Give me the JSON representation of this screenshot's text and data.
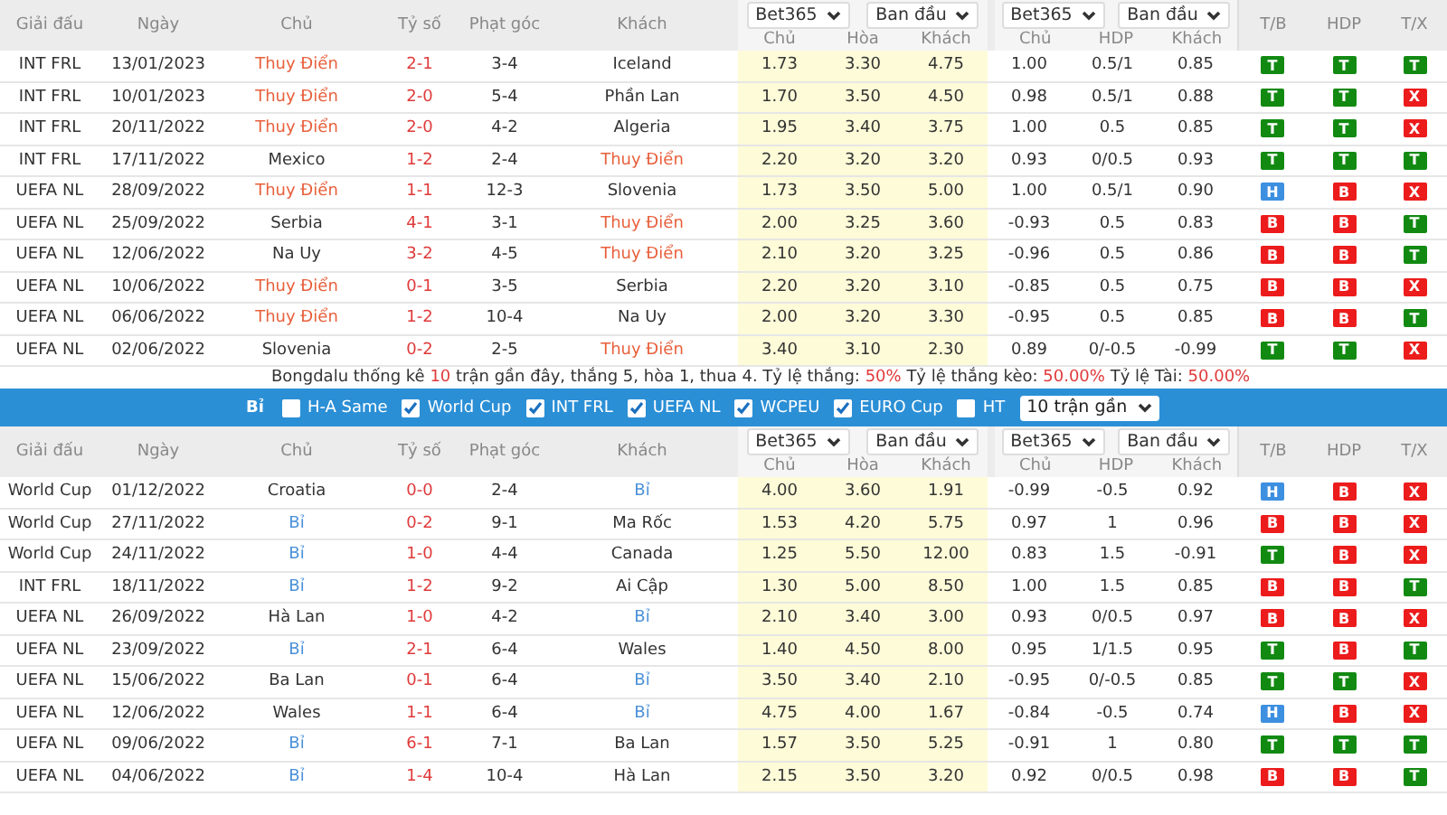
{
  "sections": [
    {
      "header": {
        "columns": [
          "Giải đấu",
          "Ngày",
          "Chủ",
          "Tỷ số",
          "Phạt góc",
          "Khách"
        ],
        "odds_groups": [
          {
            "bookmaker": "Bet365",
            "period": "Ban đầu",
            "columns": [
              "Chủ",
              "Hòa",
              "Khách"
            ]
          },
          {
            "bookmaker": "Bet365",
            "period": "Ban đầu",
            "columns": [
              "Chủ",
              "HDP",
              "Khách"
            ]
          }
        ],
        "result_columns": [
          "T/B",
          "HDP",
          "T/X"
        ]
      },
      "rows": [
        {
          "league": "INT FRL",
          "date": "13/01/2023",
          "home": {
            "name": "Thuy Điển",
            "color": "#e8603c"
          },
          "score": "2-1",
          "corners": "3-4",
          "away": {
            "name": "Iceland",
            "color": "#333333"
          },
          "odds": [
            "1.73",
            "3.30",
            "4.75"
          ],
          "handicap": [
            "1.00",
            "0.5/1",
            "0.85"
          ],
          "results": [
            {
              "label": "T",
              "color": "#128a12"
            },
            {
              "label": "T",
              "color": "#128a12"
            },
            {
              "label": "T",
              "color": "#128a12"
            }
          ]
        },
        {
          "league": "INT FRL",
          "date": "10/01/2023",
          "home": {
            "name": "Thuy Điển",
            "color": "#e8603c"
          },
          "score": "2-0",
          "corners": "5-4",
          "away": {
            "name": "Phần Lan",
            "color": "#333333"
          },
          "odds": [
            "1.70",
            "3.50",
            "4.50"
          ],
          "handicap": [
            "0.98",
            "0.5/1",
            "0.88"
          ],
          "results": [
            {
              "label": "T",
              "color": "#128a12"
            },
            {
              "label": "T",
              "color": "#128a12"
            },
            {
              "label": "X",
              "color": "#ec1c1c"
            }
          ]
        },
        {
          "league": "INT FRL",
          "date": "20/11/2022",
          "home": {
            "name": "Thuy Điển",
            "color": "#e8603c"
          },
          "score": "2-0",
          "corners": "4-2",
          "away": {
            "name": "Algeria",
            "color": "#333333"
          },
          "odds": [
            "1.95",
            "3.40",
            "3.75"
          ],
          "handicap": [
            "1.00",
            "0.5",
            "0.85"
          ],
          "results": [
            {
              "label": "T",
              "color": "#128a12"
            },
            {
              "label": "T",
              "color": "#128a12"
            },
            {
              "label": "X",
              "color": "#ec1c1c"
            }
          ]
        },
        {
          "league": "INT FRL",
          "date": "17/11/2022",
          "home": {
            "name": "Mexico",
            "color": "#333333"
          },
          "score": "1-2",
          "corners": "2-4",
          "away": {
            "name": "Thuy Điển",
            "color": "#e8603c"
          },
          "odds": [
            "2.20",
            "3.20",
            "3.20"
          ],
          "handicap": [
            "0.93",
            "0/0.5",
            "0.93"
          ],
          "results": [
            {
              "label": "T",
              "color": "#128a12"
            },
            {
              "label": "T",
              "color": "#128a12"
            },
            {
              "label": "T",
              "color": "#128a12"
            }
          ]
        },
        {
          "league": "UEFA NL",
          "date": "28/09/2022",
          "home": {
            "name": "Thuy Điển",
            "color": "#e8603c"
          },
          "score": "1-1",
          "corners": "12-3",
          "away": {
            "name": "Slovenia",
            "color": "#333333"
          },
          "odds": [
            "1.73",
            "3.50",
            "5.00"
          ],
          "handicap": [
            "1.00",
            "0.5/1",
            "0.90"
          ],
          "results": [
            {
              "label": "H",
              "color": "#3d8fe0"
            },
            {
              "label": "B",
              "color": "#ec1c1c"
            },
            {
              "label": "X",
              "color": "#ec1c1c"
            }
          ]
        },
        {
          "league": "UEFA NL",
          "date": "25/09/2022",
          "home": {
            "name": "Serbia",
            "color": "#333333"
          },
          "score": "4-1",
          "corners": "3-1",
          "away": {
            "name": "Thuy Điển",
            "color": "#e8603c"
          },
          "odds": [
            "2.00",
            "3.25",
            "3.60"
          ],
          "handicap": [
            "-0.93",
            "0.5",
            "0.83"
          ],
          "results": [
            {
              "label": "B",
              "color": "#ec1c1c"
            },
            {
              "label": "B",
              "color": "#ec1c1c"
            },
            {
              "label": "T",
              "color": "#128a12"
            }
          ]
        },
        {
          "league": "UEFA NL",
          "date": "12/06/2022",
          "home": {
            "name": "Na Uy",
            "color": "#333333"
          },
          "score": "3-2",
          "corners": "4-5",
          "away": {
            "name": "Thuy Điển",
            "color": "#e8603c"
          },
          "odds": [
            "2.10",
            "3.20",
            "3.25"
          ],
          "handicap": [
            "-0.96",
            "0.5",
            "0.86"
          ],
          "results": [
            {
              "label": "B",
              "color": "#ec1c1c"
            },
            {
              "label": "B",
              "color": "#ec1c1c"
            },
            {
              "label": "T",
              "color": "#128a12"
            }
          ]
        },
        {
          "league": "UEFA NL",
          "date": "10/06/2022",
          "home": {
            "name": "Thuy Điển",
            "color": "#e8603c"
          },
          "score": "0-1",
          "corners": "3-5",
          "away": {
            "name": "Serbia",
            "color": "#333333"
          },
          "odds": [
            "2.20",
            "3.20",
            "3.10"
          ],
          "handicap": [
            "-0.85",
            "0.5",
            "0.75"
          ],
          "results": [
            {
              "label": "B",
              "color": "#ec1c1c"
            },
            {
              "label": "B",
              "color": "#ec1c1c"
            },
            {
              "label": "X",
              "color": "#ec1c1c"
            }
          ]
        },
        {
          "league": "UEFA NL",
          "date": "06/06/2022",
          "home": {
            "name": "Thuy Điển",
            "color": "#e8603c"
          },
          "score": "1-2",
          "corners": "10-4",
          "away": {
            "name": "Na Uy",
            "color": "#333333"
          },
          "odds": [
            "2.00",
            "3.20",
            "3.30"
          ],
          "handicap": [
            "-0.95",
            "0.5",
            "0.85"
          ],
          "results": [
            {
              "label": "B",
              "color": "#ec1c1c"
            },
            {
              "label": "B",
              "color": "#ec1c1c"
            },
            {
              "label": "T",
              "color": "#128a12"
            }
          ]
        },
        {
          "league": "UEFA NL",
          "date": "02/06/2022",
          "home": {
            "name": "Slovenia",
            "color": "#333333"
          },
          "score": "0-2",
          "corners": "2-5",
          "away": {
            "name": "Thuy Điển",
            "color": "#e8603c"
          },
          "odds": [
            "3.40",
            "3.10",
            "2.30"
          ],
          "handicap": [
            "0.89",
            "0/-0.5",
            "-0.99"
          ],
          "results": [
            {
              "label": "T",
              "color": "#128a12"
            },
            {
              "label": "T",
              "color": "#128a12"
            },
            {
              "label": "X",
              "color": "#ec1c1c"
            }
          ]
        }
      ],
      "summary": [
        {
          "text": "Bongdalu thống kê ",
          "highlight": false
        },
        {
          "text": "10",
          "highlight": true
        },
        {
          "text": " trận gần đây, thắng 5, hòa 1, thua 4. Tỷ lệ thắng: ",
          "highlight": false
        },
        {
          "text": "50%",
          "highlight": true
        },
        {
          "text": " Tỷ lệ thắng kèo: ",
          "highlight": false
        },
        {
          "text": "50.00%",
          "highlight": true
        },
        {
          "text": " Tỷ lệ Tài: ",
          "highlight": false
        },
        {
          "text": "50.00%",
          "highlight": true
        }
      ]
    },
    {
      "filter_bar": {
        "team": "Bỉ",
        "filters": [
          {
            "label": "H-A Same",
            "checked": false
          },
          {
            "label": "World Cup",
            "checked": true
          },
          {
            "label": "INT FRL",
            "checked": true
          },
          {
            "label": "UEFA NL",
            "checked": true
          },
          {
            "label": "WCPEU",
            "checked": true
          },
          {
            "label": "EURO Cup",
            "checked": true
          },
          {
            "label": "HT",
            "checked": false
          }
        ],
        "range_select": "10 trận gần"
      }
    },
    {
      "header": {
        "columns": [
          "Giải đấu",
          "Ngày",
          "Chủ",
          "Tỷ số",
          "Phạt góc",
          "Khách"
        ],
        "odds_groups": [
          {
            "bookmaker": "Bet365",
            "period": "Ban đầu",
            "columns": [
              "Chủ",
              "Hòa",
              "Khách"
            ]
          },
          {
            "bookmaker": "Bet365",
            "period": "Ban đầu",
            "columns": [
              "Chủ",
              "HDP",
              "Khách"
            ]
          }
        ],
        "result_columns": [
          "T/B",
          "HDP",
          "T/X"
        ]
      },
      "rows": [
        {
          "league": "World Cup",
          "date": "01/12/2022",
          "home": {
            "name": "Croatia",
            "color": "#333333"
          },
          "score": "0-0",
          "corners": "2-4",
          "away": {
            "name": "Bỉ",
            "color": "#4a90d9"
          },
          "odds": [
            "4.00",
            "3.60",
            "1.91"
          ],
          "handicap": [
            "-0.99",
            "-0.5",
            "0.92"
          ],
          "results": [
            {
              "label": "H",
              "color": "#3d8fe0"
            },
            {
              "label": "B",
              "color": "#ec1c1c"
            },
            {
              "label": "X",
              "color": "#ec1c1c"
            }
          ]
        },
        {
          "league": "World Cup",
          "date": "27/11/2022",
          "home": {
            "name": "Bỉ",
            "color": "#4a90d9"
          },
          "score": "0-2",
          "corners": "9-1",
          "away": {
            "name": "Ma Rốc",
            "color": "#333333"
          },
          "odds": [
            "1.53",
            "4.20",
            "5.75"
          ],
          "handicap": [
            "0.97",
            "1",
            "0.96"
          ],
          "results": [
            {
              "label": "B",
              "color": "#ec1c1c"
            },
            {
              "label": "B",
              "color": "#ec1c1c"
            },
            {
              "label": "X",
              "color": "#ec1c1c"
            }
          ]
        },
        {
          "league": "World Cup",
          "date": "24/11/2022",
          "home": {
            "name": "Bỉ",
            "color": "#4a90d9"
          },
          "score": "1-0",
          "corners": "4-4",
          "away": {
            "name": "Canada",
            "color": "#333333"
          },
          "odds": [
            "1.25",
            "5.50",
            "12.00"
          ],
          "handicap": [
            "0.83",
            "1.5",
            "-0.91"
          ],
          "results": [
            {
              "label": "T",
              "color": "#128a12"
            },
            {
              "label": "B",
              "color": "#ec1c1c"
            },
            {
              "label": "X",
              "color": "#ec1c1c"
            }
          ]
        },
        {
          "league": "INT FRL",
          "date": "18/11/2022",
          "home": {
            "name": "Bỉ",
            "color": "#4a90d9"
          },
          "score": "1-2",
          "corners": "9-2",
          "away": {
            "name": "Ai Cập",
            "color": "#333333"
          },
          "odds": [
            "1.30",
            "5.00",
            "8.50"
          ],
          "handicap": [
            "1.00",
            "1.5",
            "0.85"
          ],
          "results": [
            {
              "label": "B",
              "color": "#ec1c1c"
            },
            {
              "label": "B",
              "color": "#ec1c1c"
            },
            {
              "label": "T",
              "color": "#128a12"
            }
          ]
        },
        {
          "league": "UEFA NL",
          "date": "26/09/2022",
          "home": {
            "name": "Hà Lan",
            "color": "#333333"
          },
          "score": "1-0",
          "corners": "4-2",
          "away": {
            "name": "Bỉ",
            "color": "#4a90d9"
          },
          "odds": [
            "2.10",
            "3.40",
            "3.00"
          ],
          "handicap": [
            "0.93",
            "0/0.5",
            "0.97"
          ],
          "results": [
            {
              "label": "B",
              "color": "#ec1c1c"
            },
            {
              "label": "B",
              "color": "#ec1c1c"
            },
            {
              "label": "X",
              "color": "#ec1c1c"
            }
          ]
        },
        {
          "league": "UEFA NL",
          "date": "23/09/2022",
          "home": {
            "name": "Bỉ",
            "color": "#4a90d9"
          },
          "score": "2-1",
          "corners": "6-4",
          "away": {
            "name": "Wales",
            "color": "#333333"
          },
          "odds": [
            "1.40",
            "4.50",
            "8.00"
          ],
          "handicap": [
            "0.95",
            "1/1.5",
            "0.95"
          ],
          "results": [
            {
              "label": "T",
              "color": "#128a12"
            },
            {
              "label": "B",
              "color": "#ec1c1c"
            },
            {
              "label": "T",
              "color": "#128a12"
            }
          ]
        },
        {
          "league": "UEFA NL",
          "date": "15/06/2022",
          "home": {
            "name": "Ba Lan",
            "color": "#333333"
          },
          "score": "0-1",
          "corners": "6-4",
          "away": {
            "name": "Bỉ",
            "color": "#4a90d9"
          },
          "odds": [
            "3.50",
            "3.40",
            "2.10"
          ],
          "handicap": [
            "-0.95",
            "0/-0.5",
            "0.85"
          ],
          "results": [
            {
              "label": "T",
              "color": "#128a12"
            },
            {
              "label": "T",
              "color": "#128a12"
            },
            {
              "label": "X",
              "color": "#ec1c1c"
            }
          ]
        },
        {
          "league": "UEFA NL",
          "date": "12/06/2022",
          "home": {
            "name": "Wales",
            "color": "#333333"
          },
          "score": "1-1",
          "corners": "6-4",
          "away": {
            "name": "Bỉ",
            "color": "#4a90d9"
          },
          "odds": [
            "4.75",
            "4.00",
            "1.67"
          ],
          "handicap": [
            "-0.84",
            "-0.5",
            "0.74"
          ],
          "results": [
            {
              "label": "H",
              "color": "#3d8fe0"
            },
            {
              "label": "B",
              "color": "#ec1c1c"
            },
            {
              "label": "X",
              "color": "#ec1c1c"
            }
          ]
        },
        {
          "league": "UEFA NL",
          "date": "09/06/2022",
          "home": {
            "name": "Bỉ",
            "color": "#4a90d9"
          },
          "score": "6-1",
          "corners": "7-1",
          "away": {
            "name": "Ba Lan",
            "color": "#333333"
          },
          "odds": [
            "1.57",
            "3.50",
            "5.25"
          ],
          "handicap": [
            "-0.91",
            "1",
            "0.80"
          ],
          "results": [
            {
              "label": "T",
              "color": "#128a12"
            },
            {
              "label": "T",
              "color": "#128a12"
            },
            {
              "label": "T",
              "color": "#128a12"
            }
          ]
        },
        {
          "league": "UEFA NL",
          "date": "04/06/2022",
          "home": {
            "name": "Bỉ",
            "color": "#4a90d9"
          },
          "score": "1-4",
          "corners": "10-4",
          "away": {
            "name": "Hà Lan",
            "color": "#333333"
          },
          "odds": [
            "2.15",
            "3.50",
            "3.20"
          ],
          "handicap": [
            "0.92",
            "0/0.5",
            "0.98"
          ],
          "results": [
            {
              "label": "B",
              "color": "#ec1c1c"
            },
            {
              "label": "B",
              "color": "#ec1c1c"
            },
            {
              "label": "T",
              "color": "#128a12"
            }
          ]
        }
      ]
    }
  ]
}
